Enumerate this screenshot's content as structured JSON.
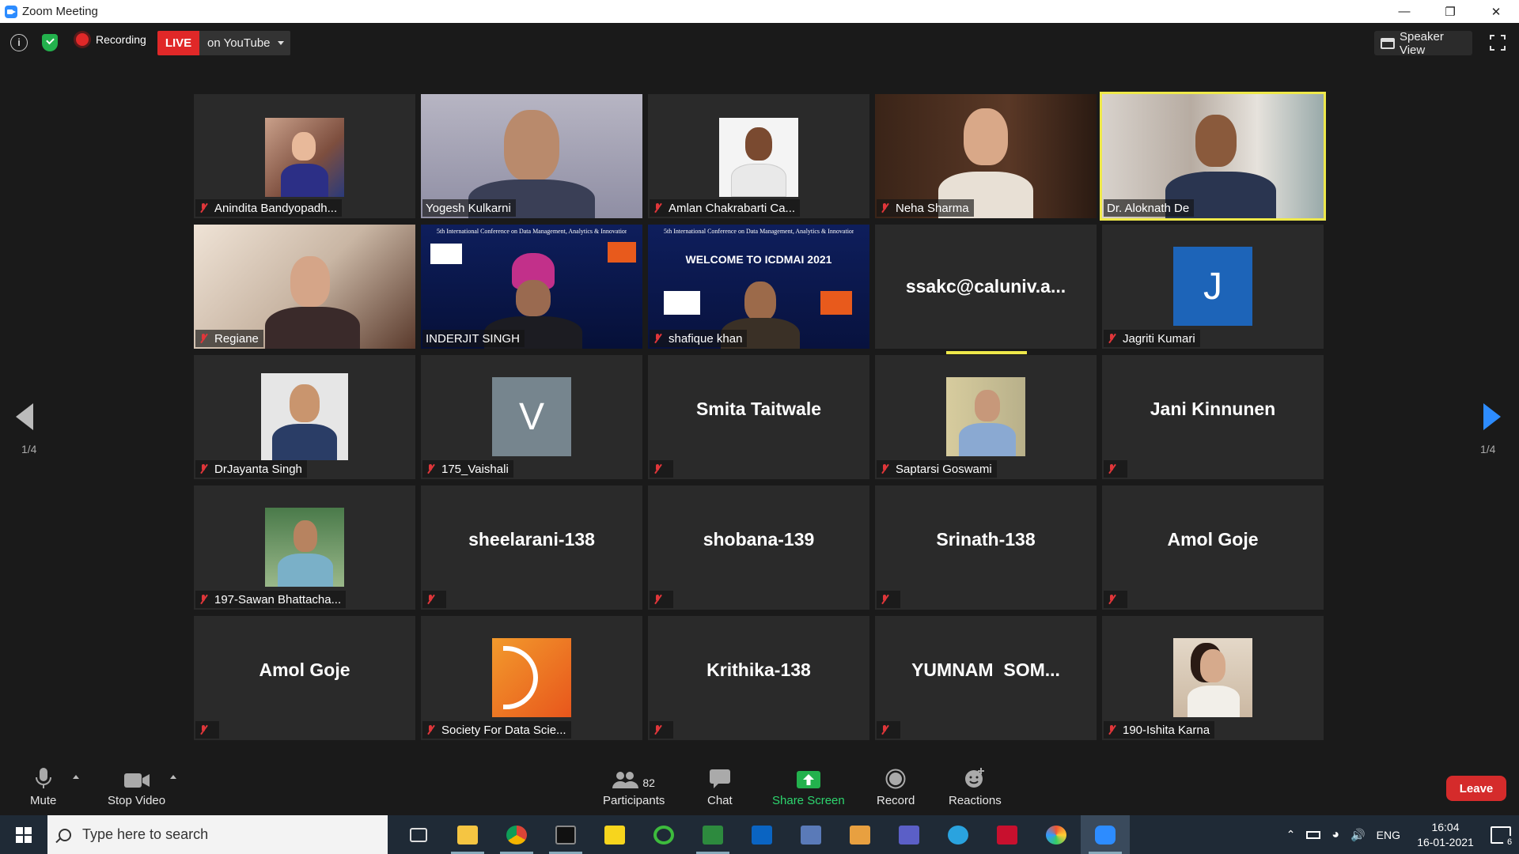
{
  "window": {
    "title": "Zoom Meeting",
    "minimize": "—",
    "restore": "❐",
    "close": "✕"
  },
  "topbar": {
    "info": "i",
    "recording_label": "Recording",
    "live_label": "LIVE",
    "live_target": "on YouTube",
    "speaker_view_label": "Speaker View"
  },
  "gallery": {
    "page_indicator": "1/4",
    "tiles": [
      {
        "name": "Anindita Bandyopadh...",
        "muted": true
      },
      {
        "name": "Yogesh Kulkarni",
        "muted": false
      },
      {
        "name": "Amlan Chakrabarti Ca...",
        "muted": true
      },
      {
        "name": "Neha Sharma",
        "muted": true
      },
      {
        "name": "Dr. Aloknath De",
        "muted": false,
        "active_speaker": true
      },
      {
        "name": "Regiane",
        "muted": true
      },
      {
        "name": "INDERJIT SINGH",
        "muted": false
      },
      {
        "name": "shafique khan",
        "muted": true
      },
      {
        "name": "ssakc@caluniv.a...",
        "muted": false
      },
      {
        "name": "Jagriti Kumari",
        "muted": true,
        "avatar_letter": "J"
      },
      {
        "name": "DrJayanta Singh",
        "muted": true
      },
      {
        "name": "175_Vaishali",
        "muted": true,
        "avatar_letter": "V"
      },
      {
        "name": "Smita Taitwale",
        "muted": true
      },
      {
        "name": "Saptarsi Goswami",
        "muted": true
      },
      {
        "name": "Jani Kinnunen",
        "muted": true
      },
      {
        "name": "197-Sawan Bhattacha...",
        "muted": true
      },
      {
        "name": "sheelarani-138",
        "muted": true
      },
      {
        "name": "shobana-139",
        "muted": true
      },
      {
        "name": "Srinath-138",
        "muted": true
      },
      {
        "name": "Amol Goje",
        "muted": true
      },
      {
        "name": "Amol Goje",
        "muted": true
      },
      {
        "name": "Society For Data Scie...",
        "muted": true
      },
      {
        "name": "Krithika-138",
        "muted": true
      },
      {
        "name": "YUMNAM  SOM...",
        "muted": true
      },
      {
        "name": "190-Ishita Karna",
        "muted": true
      }
    ],
    "slide_header": "5th International Conference on Data Management, Analytics & Innovation",
    "slide_welcome": "WELCOME TO ICDMAI 2021"
  },
  "toolbar": {
    "mute_label": "Mute",
    "stop_video_label": "Stop Video",
    "participants_label": "Participants",
    "participants_count": "82",
    "chat_label": "Chat",
    "share_screen_label": "Share Screen",
    "record_label": "Record",
    "reactions_label": "Reactions",
    "leave_label": "Leave"
  },
  "taskbar": {
    "search_placeholder": "Type here to search",
    "language": "ENG",
    "time": "16:04",
    "date": "16-01-2021",
    "notifications": "6"
  },
  "colors": {
    "accent": "#2d8cff",
    "live": "#e02828",
    "leave": "#d52b2b",
    "share": "#23b14d",
    "active_speaker": "#eee84a"
  }
}
